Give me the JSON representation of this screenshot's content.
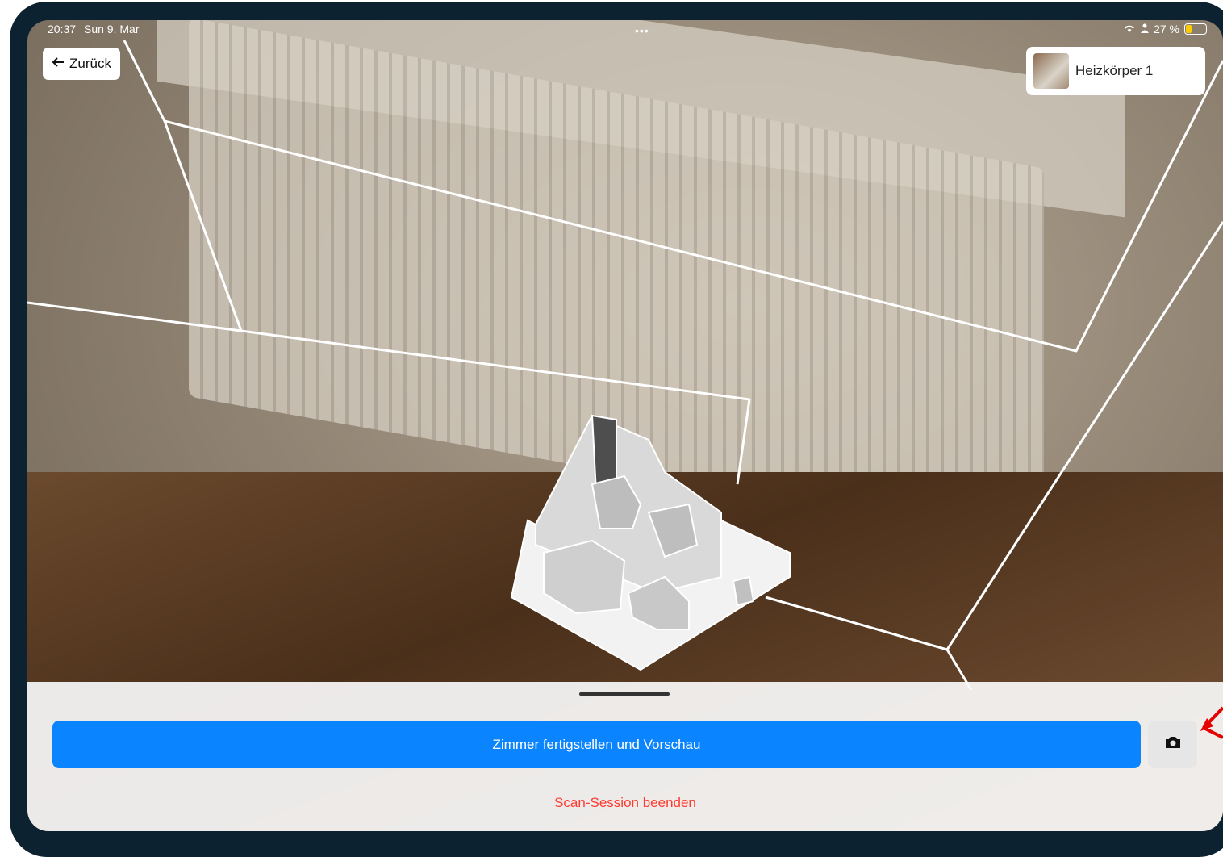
{
  "status_bar": {
    "time": "20:37",
    "date": "Sun 9. Mar",
    "battery_text": "27 %",
    "battery_level": 0.27,
    "multitask_dots": "•••",
    "icons": [
      "wifi-icon",
      "person-icon",
      "battery-icon"
    ]
  },
  "nav": {
    "back_label": "Zurück",
    "back_icon": "arrow-left-icon"
  },
  "detected_object": {
    "label": "Heizkörper 1"
  },
  "bottom_sheet": {
    "primary_label": "Zimmer fertigstellen und Vorschau",
    "camera_icon": "camera-icon",
    "end_session_label": "Scan-Session beenden"
  },
  "colors": {
    "accent": "#0a84ff",
    "destructive": "#ff3b30",
    "device_frame": "#0c2230",
    "annotation_arrow": "#e60000"
  }
}
